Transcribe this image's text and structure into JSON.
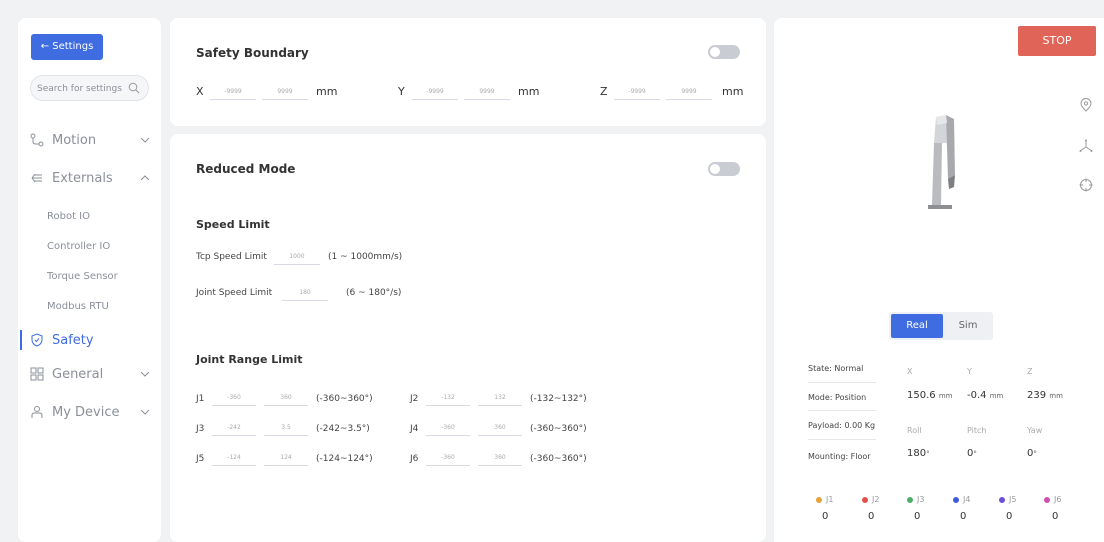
{
  "sidebar": {
    "back_label": "← Settings",
    "search_placeholder": "Search for settings",
    "nav": {
      "motion": "Motion",
      "externals": "Externals",
      "safety": "Safety",
      "general": "General",
      "my_device": "My Device"
    },
    "externals_items": [
      "Robot IO",
      "Controller IO",
      "Torque Sensor",
      "Modbus RTU"
    ]
  },
  "safety_boundary": {
    "title": "Safety Boundary",
    "enabled": false,
    "x": {
      "label": "X",
      "min": "-9999",
      "max": "9999",
      "unit": "mm"
    },
    "y": {
      "label": "Y",
      "min": "-9999",
      "max": "9999",
      "unit": "mm"
    },
    "z": {
      "label": "Z",
      "min": "-9999",
      "max": "9999",
      "unit": "mm"
    }
  },
  "reduced_mode": {
    "title": "Reduced Mode",
    "enabled": false,
    "speed_limit_heading": "Speed Limit",
    "tcp_label": "Tcp Speed Limit",
    "tcp_value": "1000",
    "tcp_range": "(1 ~ 1000mm/s)",
    "joint_label": "Joint Speed Limit",
    "joint_value": "180",
    "joint_range": "(6 ~ 180°/s)",
    "joint_range_heading": "Joint Range Limit",
    "joints": [
      {
        "name": "J1",
        "min": "-360",
        "max": "360",
        "range": "(-360~360°)"
      },
      {
        "name": "J2",
        "min": "-132",
        "max": "132",
        "range": "(-132~132°)"
      },
      {
        "name": "J3",
        "min": "-242",
        "max": "3.5",
        "range": "(-242~3.5°)"
      },
      {
        "name": "J4",
        "min": "-360",
        "max": "360",
        "range": "(-360~360°)"
      },
      {
        "name": "J5",
        "min": "-124",
        "max": "124",
        "range": "(-124~124°)"
      },
      {
        "name": "J6",
        "min": "-360",
        "max": "360",
        "range": "(-360~360°)"
      }
    ]
  },
  "right_panel": {
    "stop_label": "STOP",
    "mode_real": "Real",
    "mode_sim": "Sim",
    "state": "State: Normal",
    "mode": "Mode: Position",
    "payload": "Payload: 0.00 Kg",
    "mounting": "Mounting: Floor",
    "coords": {
      "x": {
        "label": "X",
        "value": "150.6",
        "unit": "mm"
      },
      "y": {
        "label": "Y",
        "value": "-0.4",
        "unit": "mm"
      },
      "z": {
        "label": "Z",
        "value": "239",
        "unit": "mm"
      },
      "roll": {
        "label": "Roll",
        "value": "180",
        "unit": "°"
      },
      "pitch": {
        "label": "Pitch",
        "value": "0",
        "unit": "°"
      },
      "yaw": {
        "label": "Yaw",
        "value": "0",
        "unit": "°"
      }
    },
    "joint_values": [
      {
        "name": "J1",
        "value": "0",
        "color": "#e8a23a"
      },
      {
        "name": "J2",
        "value": "0",
        "color": "#e0524a"
      },
      {
        "name": "J3",
        "value": "0",
        "color": "#4caf6a"
      },
      {
        "name": "J4",
        "value": "0",
        "color": "#3f5ad8"
      },
      {
        "name": "J5",
        "value": "0",
        "color": "#6a4fd8"
      },
      {
        "name": "J6",
        "value": "0",
        "color": "#d04fb0"
      }
    ]
  },
  "colors": {
    "accent": "#3f6ce0",
    "stop": "#e06457"
  }
}
